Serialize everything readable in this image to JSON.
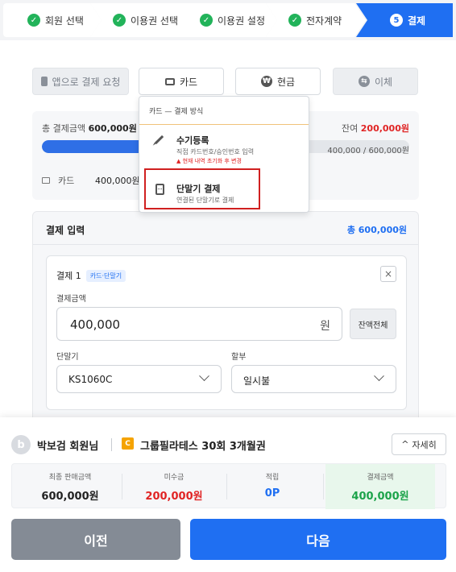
{
  "steps": [
    {
      "label": "회원 선택",
      "status": "done"
    },
    {
      "label": "이용권 선택",
      "status": "done"
    },
    {
      "label": "이용권 설정",
      "status": "done"
    },
    {
      "label": "전자계약",
      "status": "done"
    },
    {
      "label": "결제",
      "status": "active",
      "number": "5"
    }
  ],
  "methods": {
    "app": "앱으로 결제 요청",
    "card": "카드",
    "cash": "현금",
    "cash_symbol": "₩",
    "transfer": "이체",
    "transfer_symbol": "⇆"
  },
  "summary": {
    "total_label": "총 결제금액",
    "total_value": "600,000원",
    "remain_label": "잔여",
    "remain_value": "200,000원",
    "ratio": "400,000 / 600,000원",
    "progress_fraction": 0.667,
    "card_label": "카드",
    "card_amount": "400,000원"
  },
  "payment_input": {
    "title": "결제 입력",
    "total": "총 600,000원",
    "entry": {
      "title": "결제 1",
      "chip": "카드·단말기",
      "close": "×",
      "amount_label": "결제금액",
      "amount_value": "400,000",
      "amount_unit": "원",
      "remain_all_button": "잔액전체",
      "terminal_label": "단말기",
      "terminal_value": "KS1060C",
      "installment_label": "할부",
      "installment_value": "일시불"
    }
  },
  "popover": {
    "header": "카드 — 결제 방식",
    "items": [
      {
        "title": "수기등록",
        "subtitle": "직접 카드번호/승인번호 입력",
        "warning": "▲ 현재 내역 초기화 후 변경"
      },
      {
        "title": "단말기 결제",
        "subtitle": "연결된 단말기로 결제"
      }
    ]
  },
  "bottom": {
    "avatar_letter": "b",
    "member": "박보검 회원님",
    "product_icon": "C",
    "product": "그룹필라테스 30회 3개월권",
    "detail_button": "자세히",
    "detail_icon": "^",
    "stats": [
      {
        "label": "최종 판매금액",
        "value": "600,000원",
        "color": "#222222"
      },
      {
        "label": "미수금",
        "value": "200,000원",
        "color": "#e02424"
      },
      {
        "label": "적립",
        "value": "0P",
        "color": "#1f6ff2"
      },
      {
        "label": "결제금액",
        "value": "400,000원",
        "color": "#1ca34a"
      }
    ],
    "prev": "이전",
    "next": "다음"
  },
  "colors": {
    "accent": "#1f6ff2",
    "done": "#22b35a",
    "danger": "#e02424"
  }
}
